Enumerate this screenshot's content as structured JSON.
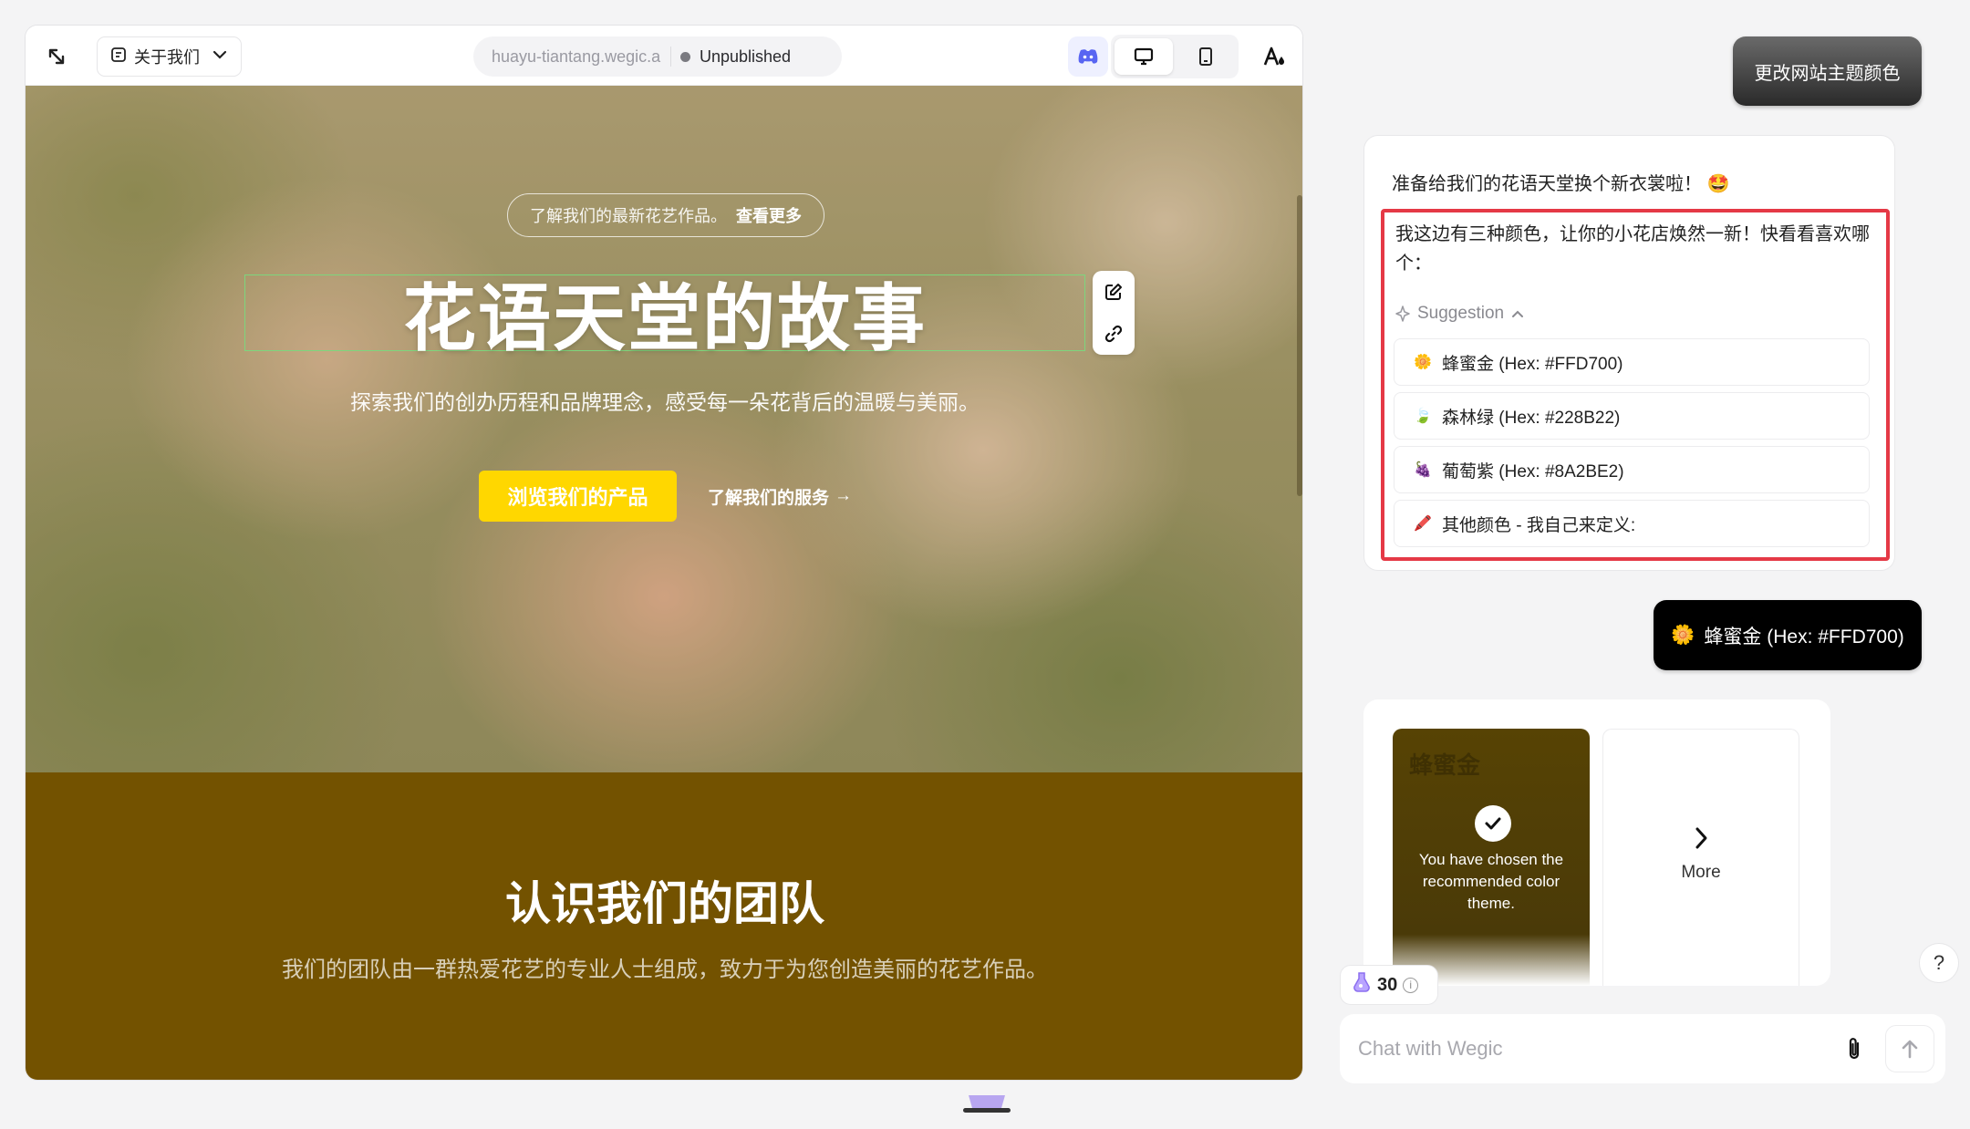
{
  "toolbar": {
    "page_selector": "关于我们",
    "url": "huayu-tiantang.wegic.app",
    "status": "Unpublished"
  },
  "hero": {
    "announcement": "了解我们的最新花艺作品。",
    "announcement_link": "查看更多",
    "title": "花语天堂的故事",
    "subtitle": "探索我们的创办历程和品牌理念，感受每一朵花背后的温暖与美丽。",
    "primary_button": "浏览我们的产品",
    "secondary_link": "了解我们的服务",
    "secondary_arrow": "→"
  },
  "team": {
    "title": "认识我们的团队",
    "subtitle": "我们的团队由一群热爱花艺的专业人士组成，致力于为您创造美丽的花艺作品。"
  },
  "chat": {
    "theme_button": "更改网站主题颜色",
    "ai_intro": "准备给我们的花语天堂换个新衣裳啦！",
    "ai_intro_emoji": "🤩",
    "ai_text": "我这边有三种颜色，让你的小花店焕然一新！快看看喜欢哪个：",
    "suggestion_label": "Suggestion",
    "suggestions": [
      {
        "emoji": "🌼",
        "label": "蜂蜜金 (Hex: #FFD700)"
      },
      {
        "emoji": "🍃",
        "label": "森林绿 (Hex: #228B22)"
      },
      {
        "emoji": "🍇",
        "label": "葡萄紫 (Hex: #8A2BE2)"
      },
      {
        "emoji": "🖍️",
        "label": "其他颜色 - 我自己来定义:"
      }
    ],
    "user_message_emoji": "🌼",
    "user_message": "蜂蜜金 (Hex: #FFD700)",
    "chosen_card_ghost": "蜂蜜金",
    "chosen_text": "You have chosen the recommended color theme.",
    "more_label": "More",
    "credits": "30",
    "help": "?",
    "input_placeholder": "Chat with Wegic"
  },
  "colors": {
    "accent_yellow": "#FFD700",
    "team_bg": "#735200",
    "highlight_red": "#E53946"
  }
}
